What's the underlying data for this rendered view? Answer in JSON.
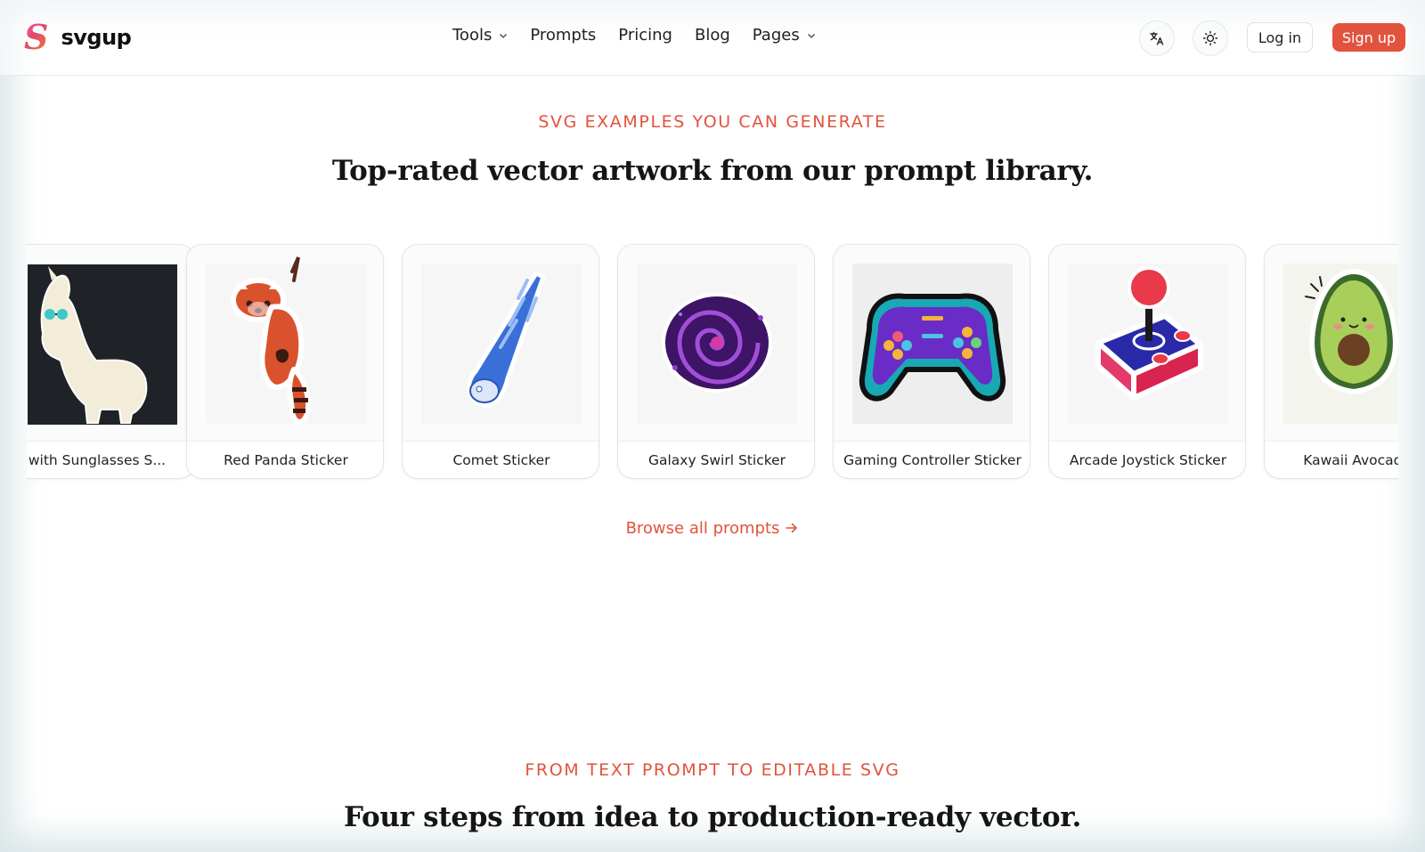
{
  "brand": {
    "logo_mark": "S",
    "name": "svgup",
    "accent": "#e2533e"
  },
  "nav": {
    "items": [
      {
        "label": "Tools",
        "has_dropdown": true
      },
      {
        "label": "Prompts",
        "has_dropdown": false
      },
      {
        "label": "Pricing",
        "has_dropdown": false
      },
      {
        "label": "Blog",
        "has_dropdown": false
      },
      {
        "label": "Pages",
        "has_dropdown": true
      }
    ]
  },
  "header_actions": {
    "language_icon": "translate-icon",
    "theme_icon": "sun-icon",
    "login_label": "Log in",
    "signup_label": "Sign up"
  },
  "examples": {
    "eyebrow": "SVG EXAMPLES YOU CAN GENERATE",
    "headline": "Top-rated vector artwork from our prompt library.",
    "cards": [
      {
        "label": "with Sunglasses S...",
        "icon": "llama-sticker"
      },
      {
        "label": "Red Panda Sticker",
        "icon": "red-panda-sticker"
      },
      {
        "label": "Comet Sticker",
        "icon": "comet-sticker"
      },
      {
        "label": "Galaxy Swirl Sticker",
        "icon": "galaxy-swirl-sticker"
      },
      {
        "label": "Gaming Controller Sticker",
        "icon": "gaming-controller-sticker"
      },
      {
        "label": "Arcade Joystick Sticker",
        "icon": "arcade-joystick-sticker"
      },
      {
        "label": "Kawaii Avocado S",
        "icon": "kawaii-avocado-sticker"
      }
    ],
    "browse_label": "Browse all prompts",
    "browse_icon": "arrow-right-icon"
  },
  "steps": {
    "eyebrow": "FROM TEXT PROMPT TO EDITABLE SVG",
    "headline": "Four steps from idea to production-ready vector."
  }
}
